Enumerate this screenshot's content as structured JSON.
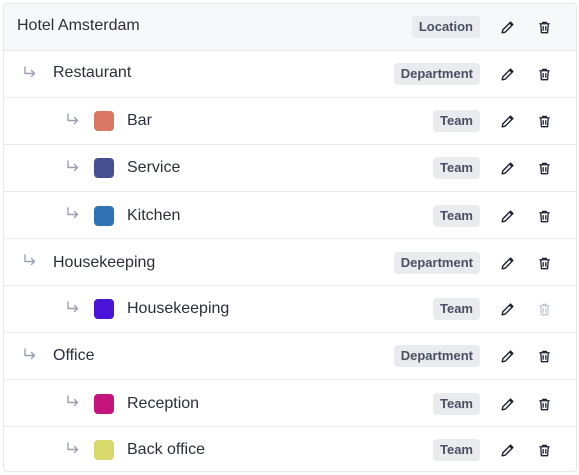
{
  "rows": [
    {
      "name": "Hotel Amsterdam",
      "type": "Location",
      "delete_enabled": true
    },
    {
      "name": "Restaurant",
      "type": "Department",
      "delete_enabled": true
    },
    {
      "name": "Bar",
      "type": "Team",
      "color": "#d97763",
      "delete_enabled": true
    },
    {
      "name": "Service",
      "type": "Team",
      "color": "#474f93",
      "delete_enabled": true
    },
    {
      "name": "Kitchen",
      "type": "Team",
      "color": "#2f73b5",
      "delete_enabled": true
    },
    {
      "name": "Housekeeping",
      "type": "Department",
      "delete_enabled": true
    },
    {
      "name": "Housekeeping",
      "type": "Team",
      "color": "#4b12d8",
      "delete_enabled": false
    },
    {
      "name": "Office",
      "type": "Department",
      "delete_enabled": true
    },
    {
      "name": "Reception",
      "type": "Team",
      "color": "#c5147b",
      "delete_enabled": true
    },
    {
      "name": "Back office",
      "type": "Team",
      "color": "#d8d86c",
      "delete_enabled": true
    }
  ],
  "icons": {
    "child_arrow": "arrow-return-right-icon",
    "edit": "pencil-icon",
    "delete": "trash-icon"
  }
}
